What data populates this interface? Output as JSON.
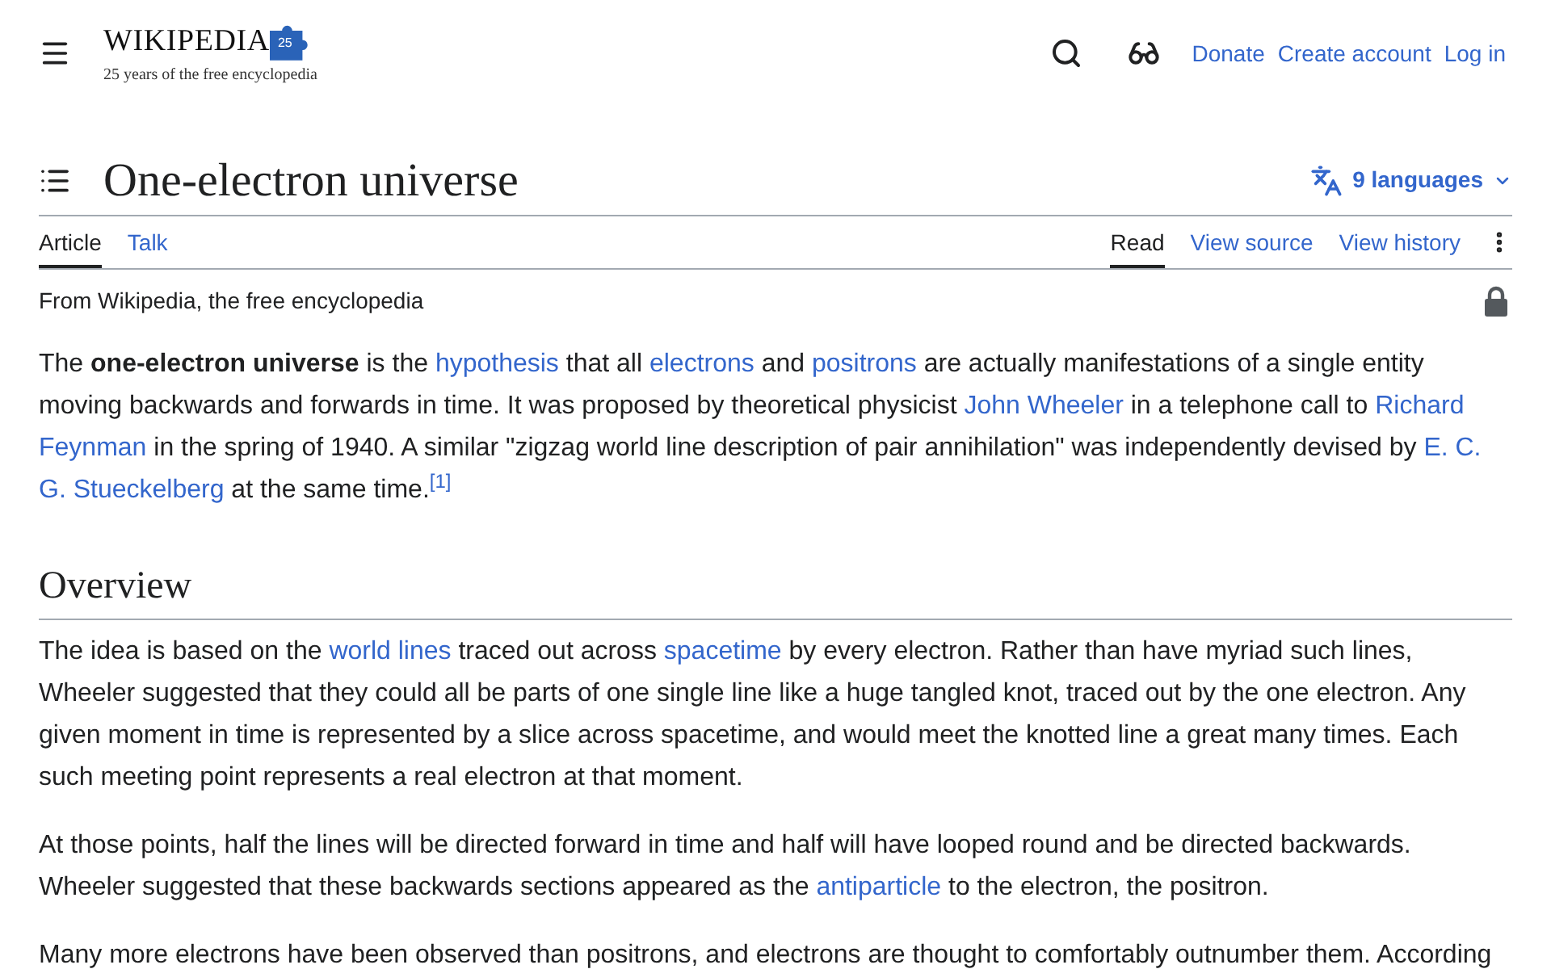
{
  "header": {
    "logo": {
      "wordmark": "WIKIPEDIA",
      "badge": "25",
      "tagline": "25 years of the free encyclopedia"
    },
    "links": [
      "Donate",
      "Create account",
      "Log in"
    ]
  },
  "title": "One-electron universe",
  "languages": "9 languages",
  "tabs_left": [
    {
      "label": "Article",
      "selected": true
    },
    {
      "label": "Talk",
      "selected": false
    }
  ],
  "tabs_right": [
    {
      "label": "Read",
      "selected": true
    },
    {
      "label": "View source",
      "selected": false
    },
    {
      "label": "View history",
      "selected": false
    }
  ],
  "tagline": "From Wikipedia, the free encyclopedia",
  "content": [
    {
      "kind": "paragraph",
      "segments": [
        {
          "kind": "text",
          "text": "The "
        },
        {
          "kind": "bold",
          "text": "one-electron universe"
        },
        {
          "kind": "text",
          "text": " is the "
        },
        {
          "kind": "link",
          "text": "hypothesis"
        },
        {
          "kind": "text",
          "text": " that all "
        },
        {
          "kind": "link",
          "text": "electrons"
        },
        {
          "kind": "text",
          "text": " and "
        },
        {
          "kind": "link",
          "text": "positrons"
        },
        {
          "kind": "text",
          "text": " are actually manifestations of a single entity moving backwards and forwards in time. It was proposed by theoretical physicist "
        },
        {
          "kind": "link",
          "text": "John Wheeler"
        },
        {
          "kind": "text",
          "text": " in a telephone call to "
        },
        {
          "kind": "link",
          "parts": [
            "Richard",
            "Feynman"
          ]
        },
        {
          "kind": "text",
          "text": " in the spring of 1940. A similar \"zigzag world line description of pair annihilation\" was independently devised by "
        },
        {
          "kind": "link",
          "parts": [
            "E. C.",
            "G. Stueckelberg"
          ]
        },
        {
          "kind": "text",
          "text": " at the same time."
        },
        {
          "kind": "ref",
          "text": "[1]"
        }
      ]
    },
    {
      "kind": "heading",
      "text": "Overview"
    },
    {
      "kind": "paragraph",
      "segments": [
        {
          "kind": "text",
          "text": "The idea is based on the "
        },
        {
          "kind": "link",
          "text": "world lines"
        },
        {
          "kind": "text",
          "text": " traced out across "
        },
        {
          "kind": "link",
          "text": "spacetime"
        },
        {
          "kind": "text",
          "text": " by every electron. Rather than have myriad such lines, Wheeler suggested that they could all be parts of one single line like a huge tangled knot, traced out by the one electron. Any given moment in time is represented by a slice across spacetime, and would meet the knotted line a great many times. Each such meeting point represents a real electron at that moment."
        }
      ]
    },
    {
      "kind": "paragraph",
      "segments": [
        {
          "kind": "text",
          "text": "At those points, half the lines will be directed forward in time and half will have looped round and be directed backwards. Wheeler suggested that these backwards sections appeared as the "
        },
        {
          "kind": "link",
          "text": "antiparticle"
        },
        {
          "kind": "text",
          "text": " to the electron, the positron."
        }
      ]
    },
    {
      "kind": "paragraph",
      "segments": [
        {
          "kind": "text",
          "text": "Many more electrons have been observed than positrons, and electrons are thought to comfortably outnumber them. According"
        }
      ]
    }
  ]
}
